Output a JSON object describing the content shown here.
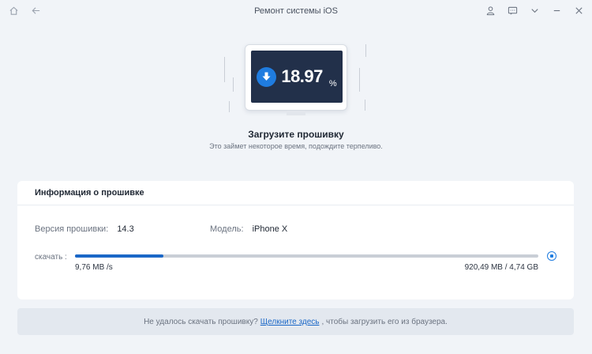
{
  "window": {
    "title": "Ремонт системы iOS"
  },
  "titlebar": {
    "left_icons": [
      "home-icon",
      "back-arrow-icon"
    ],
    "right_icons": [
      "user-icon",
      "feedback-icon",
      "chevron-down-icon",
      "minimize-icon",
      "close-icon"
    ]
  },
  "download": {
    "percent_value": "18.97",
    "percent_sign": "%",
    "progress": 0.19,
    "heading": "Загрузите прошивку",
    "subheading": "Это займет некоторое время, подождите терпеливо."
  },
  "firmware_info": {
    "title": "Информация о прошивке",
    "version_label": "Версия прошивки:",
    "version_value": "14.3",
    "model_label": "Модель:",
    "model_value": "iPhone X",
    "download_label": "скачать :",
    "speed": "9,76 MB /s",
    "size": "920,49 MB / 4,74 GB"
  },
  "banner": {
    "before": "Не удалось скачать прошивку?",
    "link": "Щелкните здесь",
    "after": ", чтобы загрузить его из браузера."
  },
  "colors": {
    "accent": "#1f7ce0",
    "progress_fill": "#1a67c7",
    "screen": "#22304a",
    "background": "#f1f4f8"
  }
}
